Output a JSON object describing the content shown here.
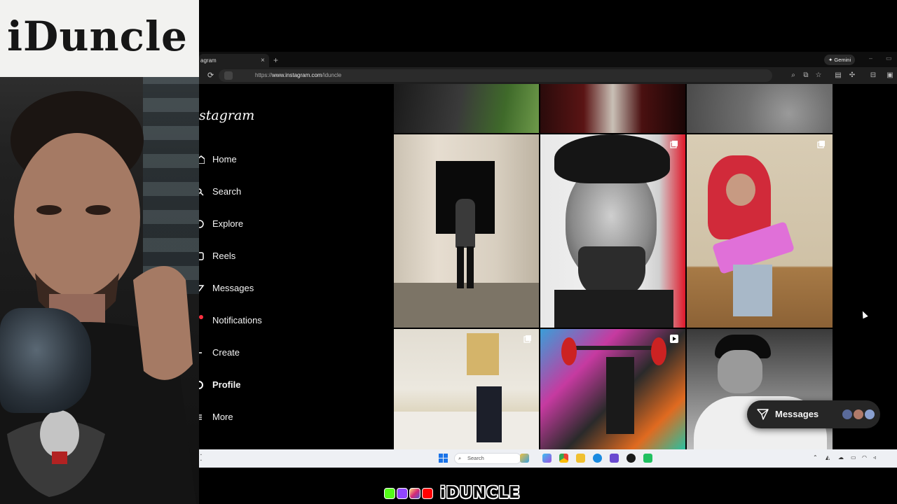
{
  "webcam": {
    "banner_text": "iDuncle"
  },
  "browser": {
    "tab_title": "agram",
    "tab_close": "×",
    "new_tab": "+",
    "gemini_label": "✦ Gemini",
    "url_prefix": "https://",
    "url_host": "www.instagram.com",
    "url_path": "/iduncle"
  },
  "instagram": {
    "logo": "stagram",
    "nav": [
      {
        "label": "Home",
        "icon": "home-icon"
      },
      {
        "label": "Search",
        "icon": "search-icon"
      },
      {
        "label": "Explore",
        "icon": "explore-icon"
      },
      {
        "label": "Reels",
        "icon": "reels-icon"
      },
      {
        "label": "Messages",
        "icon": "messages-icon"
      },
      {
        "label": "Notifications",
        "icon": "heart-icon"
      },
      {
        "label": "Create",
        "icon": "plus-icon"
      },
      {
        "label": "Profile",
        "icon": "profile-icon"
      },
      {
        "label": "More",
        "icon": "menu-icon"
      }
    ],
    "messages_button": "Messages"
  },
  "taskbar": {
    "search_placeholder": "Search"
  },
  "brand": {
    "text": "iDUNCLE",
    "icons": [
      "kick-icon",
      "twitch-icon",
      "instagram-icon",
      "youtube-icon"
    ]
  },
  "colors": {
    "background": "#000000",
    "notification_dot": "#ff3040",
    "messages_pill": "#262626"
  }
}
